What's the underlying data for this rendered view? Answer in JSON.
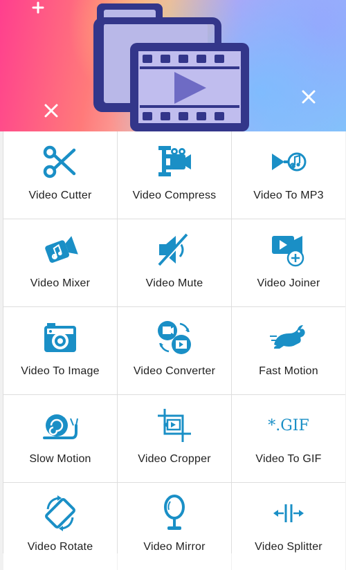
{
  "theme": {
    "accent": "#1a8fc6",
    "tile_bg": "#ffffff",
    "divider": "#dddddd",
    "text": "#1f1f1f"
  },
  "tiles": [
    {
      "label": "Video Cutter",
      "icon": "scissors-icon"
    },
    {
      "label": "Video Compress",
      "icon": "clamp-camera-icon"
    },
    {
      "label": "Video To MP3",
      "icon": "video-to-music-icon"
    },
    {
      "label": "Video Mixer",
      "icon": "camera-music-icon"
    },
    {
      "label": "Video Mute",
      "icon": "speaker-mute-icon"
    },
    {
      "label": "Video Joiner",
      "icon": "video-add-icon"
    },
    {
      "label": "Video To Image",
      "icon": "photo-camera-icon"
    },
    {
      "label": "Video Converter",
      "icon": "convert-video-icon"
    },
    {
      "label": "Fast Motion",
      "icon": "rabbit-icon"
    },
    {
      "label": "Slow Motion",
      "icon": "snail-icon"
    },
    {
      "label": "Video Cropper",
      "icon": "crop-video-icon"
    },
    {
      "label": "Video To GIF",
      "icon": "gif-icon"
    },
    {
      "label": "Video Rotate",
      "icon": "rotate-icon"
    },
    {
      "label": "Video Mirror",
      "icon": "mirror-icon"
    },
    {
      "label": "Video Splitter",
      "icon": "split-icon"
    }
  ],
  "gif_text": "*.GIF"
}
